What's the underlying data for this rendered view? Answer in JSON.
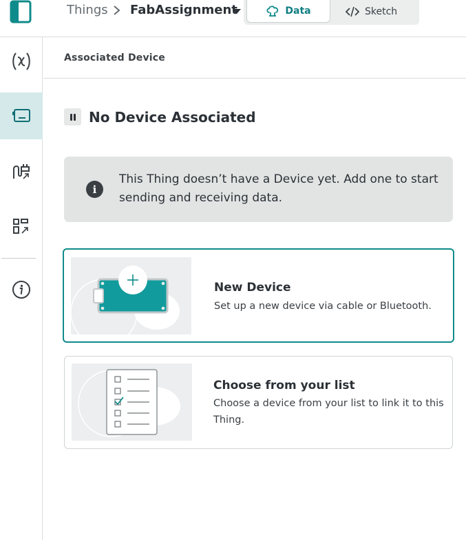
{
  "header": {
    "breadcrumb_root": "Things",
    "thing_name": "FabAssignment",
    "tabs": [
      {
        "label": "Data",
        "icon": "cloud-data-icon",
        "active": true
      },
      {
        "label": "Sketch",
        "icon": "code-icon",
        "active": false
      }
    ]
  },
  "sidebar": {
    "items": [
      {
        "icon": "variables-icon",
        "active": false
      },
      {
        "icon": "device-icon",
        "active": true
      },
      {
        "icon": "network-plug-icon",
        "active": false
      },
      {
        "icon": "dashboard-link-icon",
        "active": false
      },
      {
        "icon": "info-icon",
        "active": false
      }
    ]
  },
  "main": {
    "section_title": "Associated Device",
    "status": "No Device Associated",
    "notice": "This Thing doesn’t have a Device yet. Add one to start sending and receiving data.",
    "options": [
      {
        "title": "New Device",
        "description": "Set up a new device via cable or Bluetooth.",
        "selected": true
      },
      {
        "title": "Choose from your list",
        "description": "Choose a device from your list to link it to this Thing.",
        "selected": false
      }
    ]
  },
  "colors": {
    "accent": "#108b8b",
    "board_teal": "#129b9c",
    "rail_active_bg": "#d5e9ea",
    "notice_bg": "#e2e4e4"
  }
}
